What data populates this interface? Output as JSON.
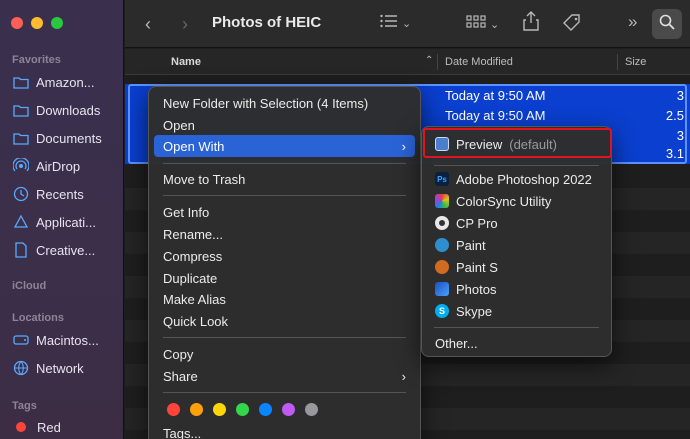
{
  "window": {
    "title": "Photos of HEIC"
  },
  "sidebar": {
    "favorites_label": "Favorites",
    "favorites": [
      {
        "label": "Amazon...",
        "icon": "folder-icon"
      },
      {
        "label": "Downloads",
        "icon": "folder-icon"
      },
      {
        "label": "Documents",
        "icon": "folder-icon"
      },
      {
        "label": "AirDrop",
        "icon": "airdrop-icon"
      },
      {
        "label": "Recents",
        "icon": "clock-icon"
      },
      {
        "label": "Applicati...",
        "icon": "applications-icon"
      },
      {
        "label": "Creative...",
        "icon": "document-icon"
      }
    ],
    "icloud_label": "iCloud",
    "locations_label": "Locations",
    "locations": [
      {
        "label": "Macintos...",
        "icon": "disk-icon"
      },
      {
        "label": "Network",
        "icon": "globe-icon"
      }
    ],
    "tags_label": "Tags",
    "tags": [
      {
        "label": "Red",
        "color": "#ff453a"
      }
    ]
  },
  "columns": {
    "name": "Name",
    "date": "Date Modified",
    "size": "Size"
  },
  "rows": [
    {
      "date": "Today at 9:50 AM",
      "size": "3"
    },
    {
      "date": "Today at 9:50 AM",
      "size": "2.5"
    },
    {
      "date": "",
      "size": "3"
    },
    {
      "date": "",
      "size": "3.1"
    }
  ],
  "context_menu": {
    "items": [
      "New Folder with Selection (4 Items)",
      "Open",
      "Open With",
      "Move to Trash",
      "Get Info",
      "Rename...",
      "Compress",
      "Duplicate",
      "Make Alias",
      "Quick Look",
      "Copy",
      "Share",
      "Tags..."
    ],
    "tag_colors": [
      "#ff453a",
      "#ff9f0a",
      "#ffd60a",
      "#32d74b",
      "#0a84ff",
      "#bf5af2",
      "#98989d"
    ]
  },
  "open_with": {
    "default_app": "Preview",
    "default_suffix": "(default)",
    "apps": [
      {
        "label": "Adobe Photoshop 2022",
        "icon": "photoshop-icon",
        "color": "#0b1f3f"
      },
      {
        "label": "ColorSync Utility",
        "icon": "colorsync-icon",
        "color": "#e0a020"
      },
      {
        "label": "CP Pro",
        "icon": "cppro-icon",
        "color": "#3a3a3a"
      },
      {
        "label": "Paint",
        "icon": "paint-icon",
        "color": "#2d8fd0"
      },
      {
        "label": "Paint S",
        "icon": "paints-icon",
        "color": "#d06b20"
      },
      {
        "label": "Photos",
        "icon": "photos-icon",
        "color": "#2a6fd6"
      },
      {
        "label": "Skype",
        "icon": "skype-icon",
        "color": "#00aff0"
      }
    ],
    "other": "Other..."
  }
}
